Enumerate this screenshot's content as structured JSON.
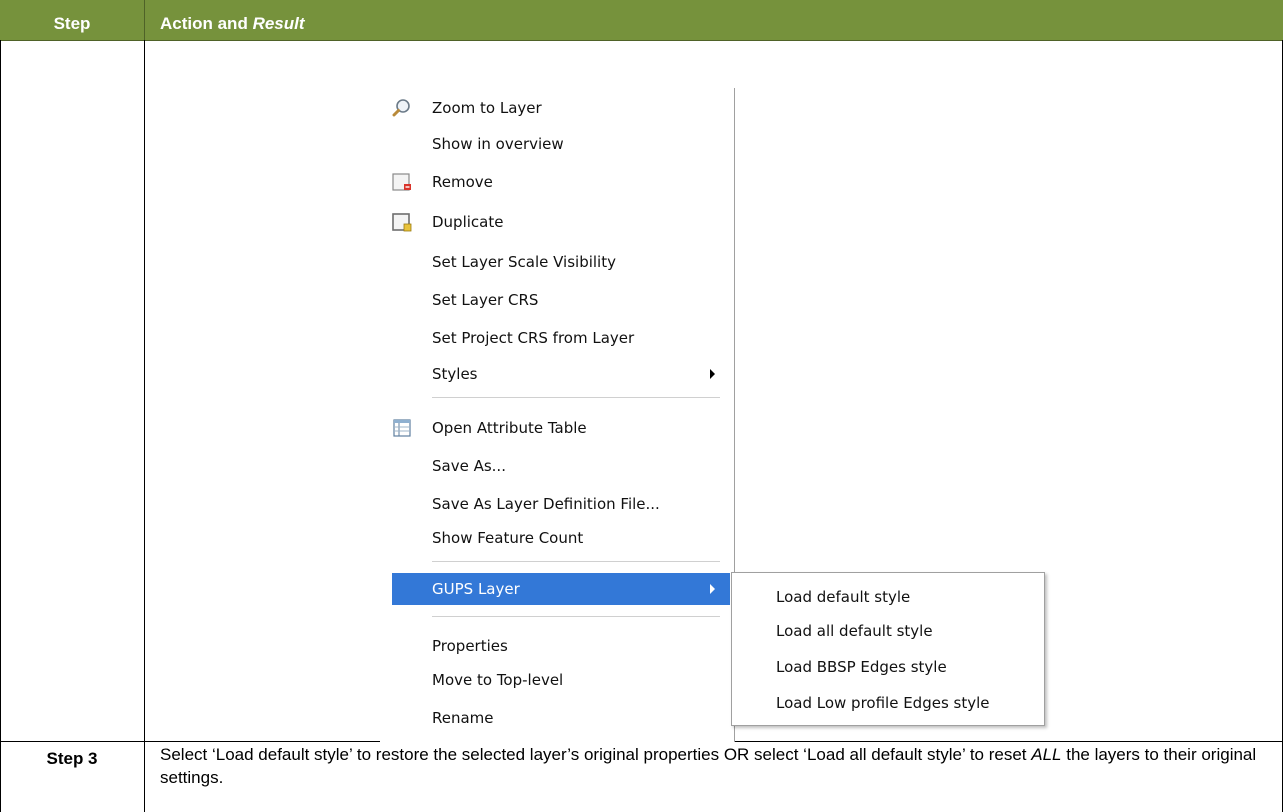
{
  "table": {
    "header_step": "Step",
    "header_action": "Action and ",
    "header_result": "Result",
    "step_label": "Step 3",
    "description_part1": "Select ‘Load default style’ to restore the selected layer’s original properties OR select ‘Load all default style’ to reset ",
    "description_emph": "ALL",
    "description_part2": " the layers to their original settings."
  },
  "context_menu": {
    "items": [
      {
        "label": "Zoom to Layer",
        "icon": "zoom-icon"
      },
      {
        "label": "Show in overview"
      },
      {
        "label": "Remove",
        "icon": "remove-layer-icon"
      },
      {
        "label": "Duplicate",
        "icon": "duplicate-layer-icon"
      },
      {
        "label": "Set Layer Scale Visibility"
      },
      {
        "label": "Set Layer CRS"
      },
      {
        "label": "Set Project CRS from Layer"
      },
      {
        "label": "Styles",
        "submenu": true
      },
      {
        "label": "Open Attribute Table",
        "icon": "attribute-table-icon"
      },
      {
        "label": "Save As..."
      },
      {
        "label": "Save As Layer Definition File..."
      },
      {
        "label": "Show Feature Count"
      },
      {
        "label": "GUPS Layer",
        "submenu": true,
        "selected": true
      },
      {
        "label": "Properties"
      },
      {
        "label": "Move to Top-level"
      },
      {
        "label": "Rename"
      }
    ]
  },
  "submenu": {
    "items": [
      {
        "label": "Load default style"
      },
      {
        "label": "Load all default style"
      },
      {
        "label": "Load BBSP Edges style"
      },
      {
        "label": "Load Low profile Edges style"
      }
    ]
  },
  "colors": {
    "header_bg": "#76923c",
    "selection": "#3378d7"
  }
}
